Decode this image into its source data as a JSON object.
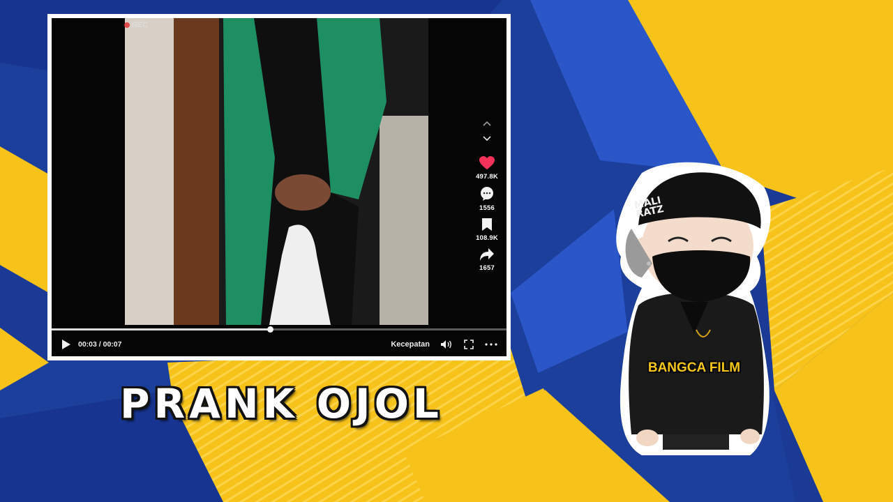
{
  "colors": {
    "background_blue": "#1c3f9c",
    "accent_yellow": "#f7c21a",
    "like_red": "#f5335a",
    "jacket_green": "#1d8f63"
  },
  "player": {
    "rec_label": "REC",
    "likes": "497.8K",
    "comments": "1556",
    "saves": "108.9K",
    "shares": "1657",
    "time_display": "00:03 / 00:07",
    "progress": 0.48,
    "speed_label": "Kecepatan",
    "icons": [
      "chevron-up-icon",
      "chevron-down-icon",
      "heart-icon",
      "comment-icon",
      "bookmark-icon",
      "share-icon",
      "play-icon",
      "volume-icon",
      "fullscreen-icon",
      "more-icon"
    ]
  },
  "title": "PRANK OJOL",
  "mascot": {
    "cap_text": "MALI RATZ",
    "jacket_label": "BANGCA FILM"
  }
}
